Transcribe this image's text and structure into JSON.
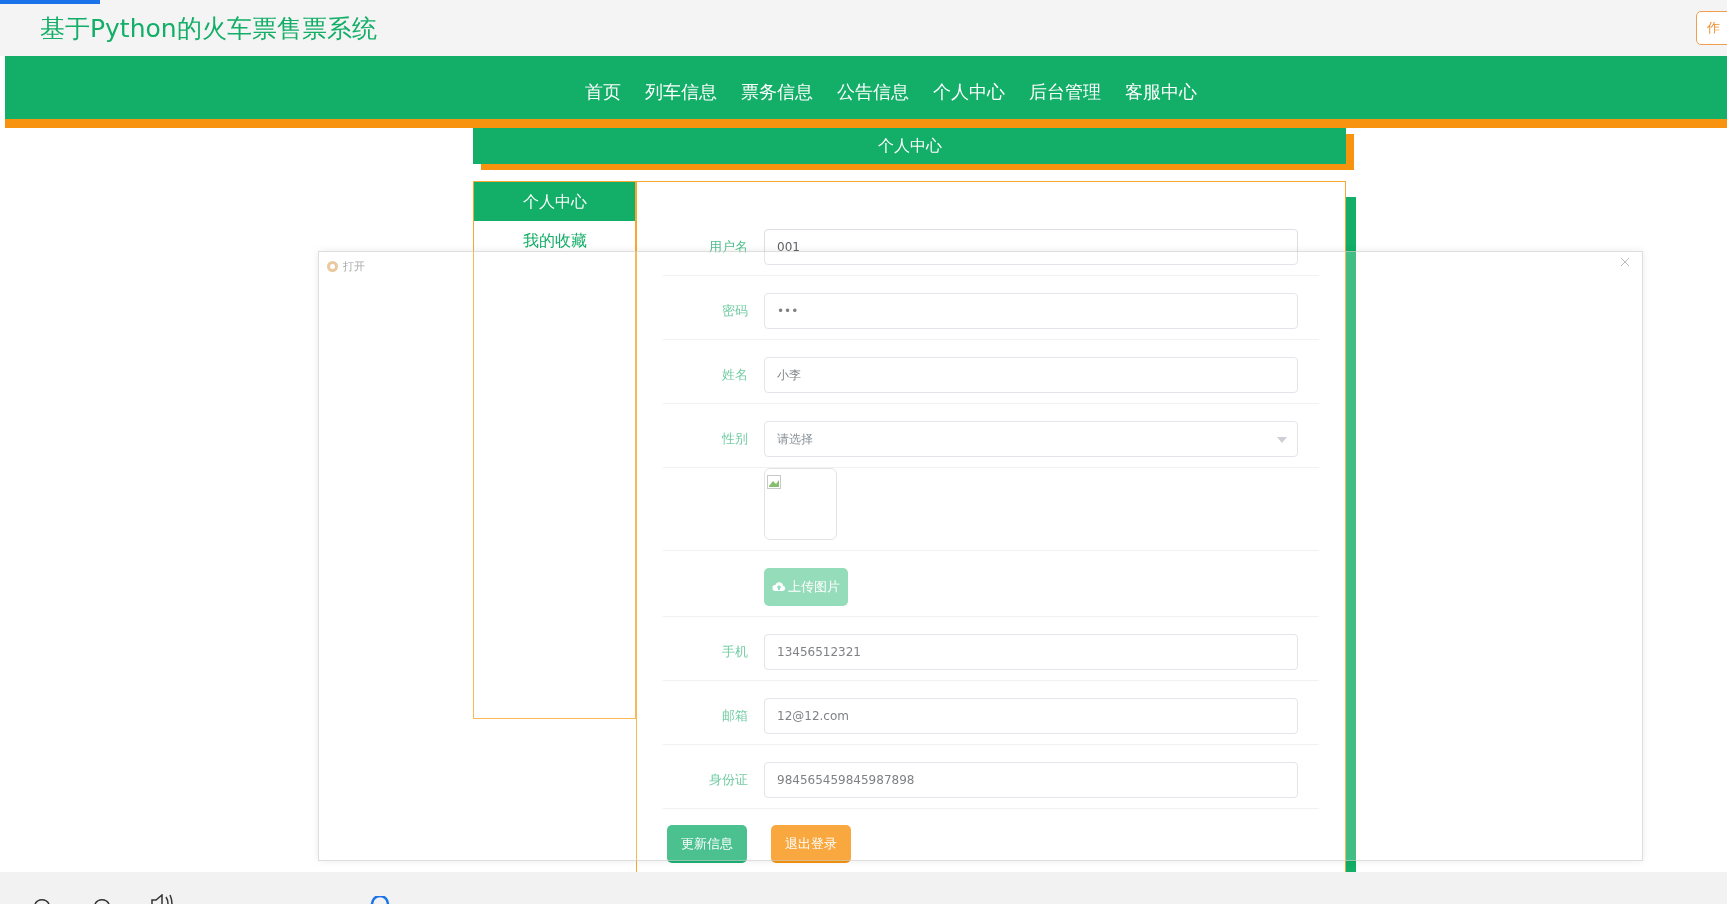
{
  "header": {
    "title": "基于Python的火车票售票系统",
    "author_button": "作"
  },
  "nav": [
    {
      "label": "首页"
    },
    {
      "label": "列车信息"
    },
    {
      "label": "票务信息"
    },
    {
      "label": "公告信息"
    },
    {
      "label": "个人中心"
    },
    {
      "label": "后台管理"
    },
    {
      "label": "客服中心"
    }
  ],
  "section_title": "个人中心",
  "sidebar": [
    {
      "label": "个人中心",
      "selected": true
    },
    {
      "label": "我的收藏",
      "selected": false
    }
  ],
  "form": {
    "fields": [
      {
        "kind": "text",
        "label": "用户名",
        "value": "001"
      },
      {
        "kind": "text",
        "label": "密码",
        "value": "•••"
      },
      {
        "kind": "text",
        "label": "姓名",
        "value": "小李"
      },
      {
        "kind": "select",
        "label": "性别",
        "placeholder": "请选择"
      },
      {
        "kind": "image"
      },
      {
        "kind": "upload",
        "button": "上传图片"
      },
      {
        "kind": "text",
        "label": "手机",
        "value": "13456512321"
      },
      {
        "kind": "text",
        "label": "邮箱",
        "value": "12@12.com"
      },
      {
        "kind": "text",
        "label": "身份证",
        "value": "984565459845987898"
      }
    ],
    "buttons": [
      {
        "kind": "primary",
        "label": "更新信息"
      },
      {
        "kind": "warning",
        "label": "退出登录"
      }
    ]
  },
  "dialog": {
    "title": "打开"
  }
}
